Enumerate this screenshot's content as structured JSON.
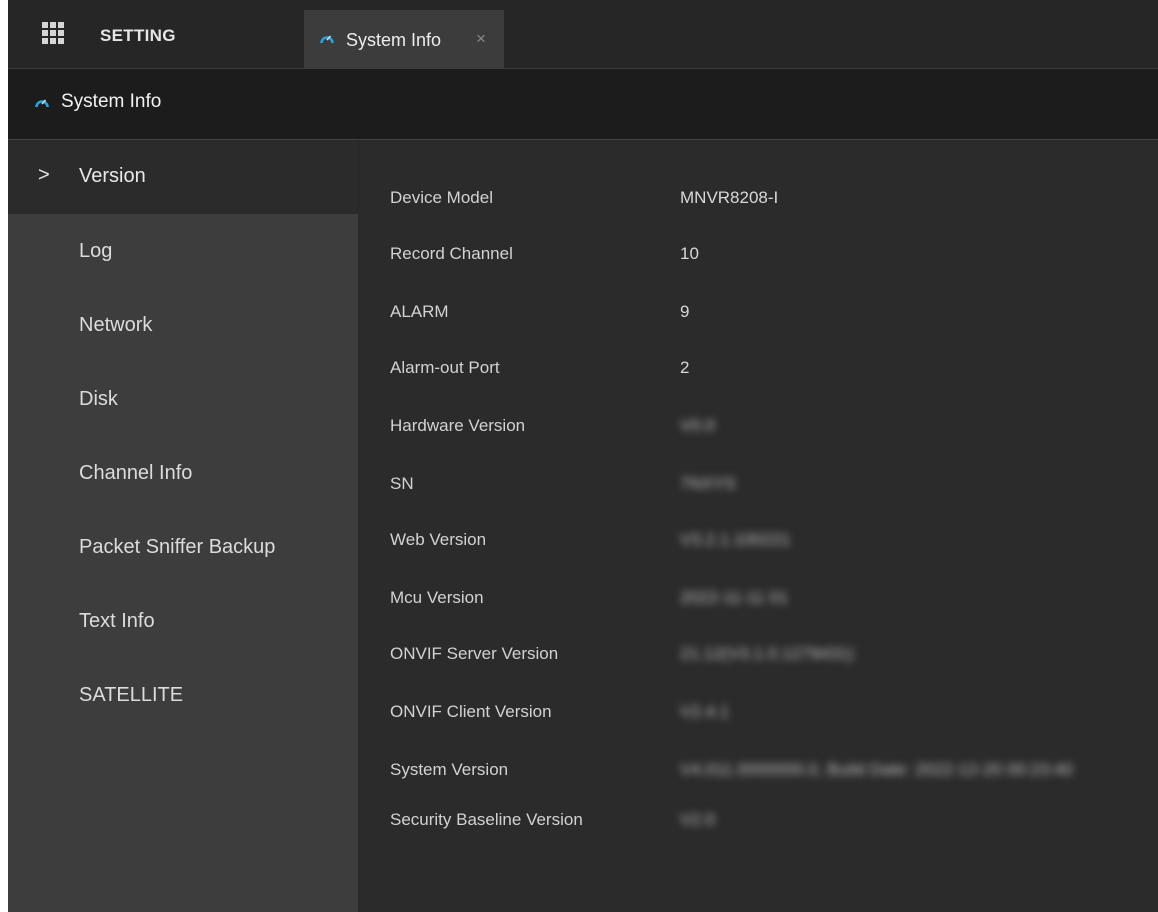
{
  "topbar": {
    "menu_label": "SETTING",
    "tab": {
      "label": "System Info",
      "close_glyph": "×"
    }
  },
  "header": {
    "title": "System Info"
  },
  "sidebar": {
    "items": [
      {
        "label": "Version",
        "active": true,
        "marker": ">"
      },
      {
        "label": "Log"
      },
      {
        "label": "Network"
      },
      {
        "label": "Disk"
      },
      {
        "label": "Channel Info"
      },
      {
        "label": "Packet Sniffer Backup"
      },
      {
        "label": "Text Info"
      },
      {
        "label": "SATELLITE"
      }
    ]
  },
  "version_info": {
    "rows": [
      {
        "label": "Device Model",
        "value": "MNVR8208-I"
      },
      {
        "label": "Record Channel",
        "value": "10"
      },
      {
        "label": "ALARM",
        "value": "9"
      },
      {
        "label": "Alarm-out Port",
        "value": "2"
      },
      {
        "label": "Hardware Version",
        "value": "",
        "redacted": true
      },
      {
        "label": "SN",
        "value": "",
        "redacted": true
      },
      {
        "label": "Web Version",
        "value": "",
        "redacted": true
      },
      {
        "label": "Mcu Version",
        "value": "",
        "redacted": true
      },
      {
        "label": "ONVIF Server Version",
        "value": "",
        "redacted": true
      },
      {
        "label": "ONVIF Client Version",
        "value": "",
        "redacted": true
      },
      {
        "label": "System Version",
        "value": "",
        "redacted": true
      },
      {
        "label": "Security Baseline Version",
        "value": "",
        "redacted": true
      }
    ]
  },
  "colors": {
    "accent": "#2aa3e0",
    "background": "#2b2b2b",
    "sidebar": "#3d3d3d",
    "titlebar": "#1c1c1c"
  }
}
